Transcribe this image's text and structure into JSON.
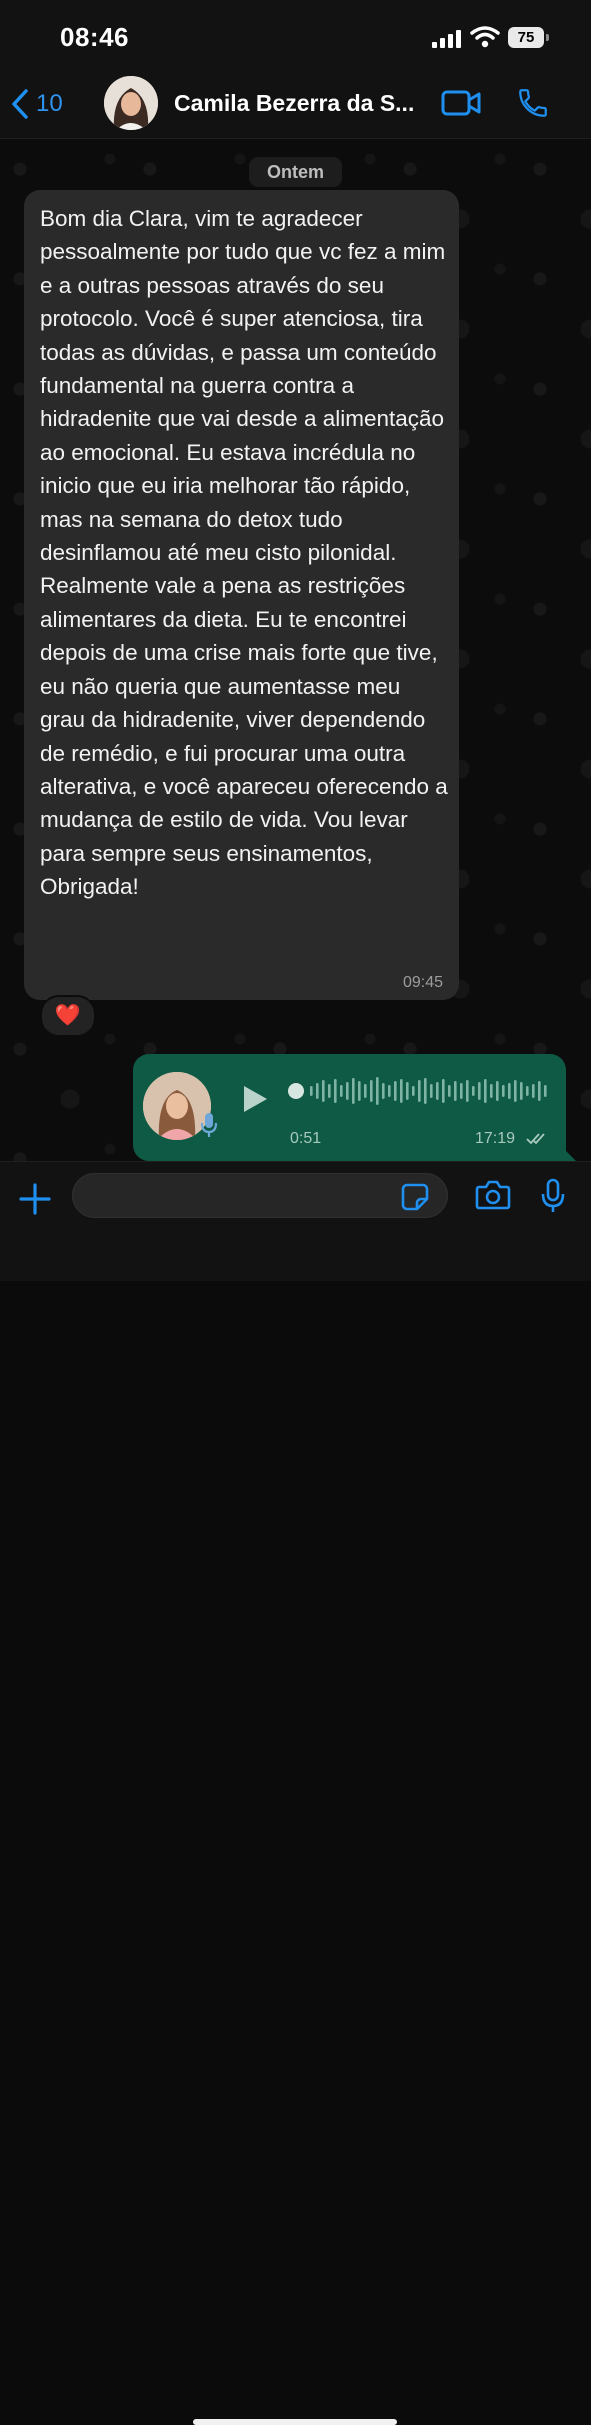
{
  "status_bar": {
    "time": "08:46",
    "battery": "75"
  },
  "header": {
    "back_count": "10",
    "contact_name": "Camila Bezerra da S...",
    "icons": [
      "back-chevron-icon",
      "video-call-icon",
      "phone-icon"
    ]
  },
  "chat": {
    "date_label": "Ontem",
    "incoming": {
      "text": "Bom dia Clara, vim te agradecer pessoalmente por tudo que vc fez a mim e a outras pessoas através do seu protocolo. Você é super atenciosa, tira todas as dúvidas, e passa um conteúdo fundamental na guerra contra a hidradenite que vai desde a alimentação ao emocional. Eu estava incrédula no inicio que eu iria melhorar tão rápido, mas na semana do detox tudo desinflamou até meu cisto pilonidal. Realmente vale a pena as restrições alimentares da dieta. Eu te encontrei depois de uma crise mais forte que tive, eu não queria que aumentasse meu grau da hidradenite, viver dependendo de remédio, e fui procurar uma outra alterativa, e você apareceu oferecendo a mudança de estilo de vida. Vou levar para sempre seus ensinamentos, Obrigada!",
      "time": "09:45",
      "reaction": "❤️"
    },
    "outgoing_audio": {
      "duration": "0:51",
      "time": "17:19",
      "status": "read"
    }
  },
  "input_bar": {
    "placeholder": "",
    "icons": [
      "plus-icon",
      "sticker-icon",
      "camera-icon",
      "microphone-icon"
    ]
  },
  "colors": {
    "accent": "#1f8ff0",
    "incoming_bubble": "#2a2a2a",
    "outgoing_bubble": "#0e5a45",
    "background": "#0b0b0b"
  }
}
